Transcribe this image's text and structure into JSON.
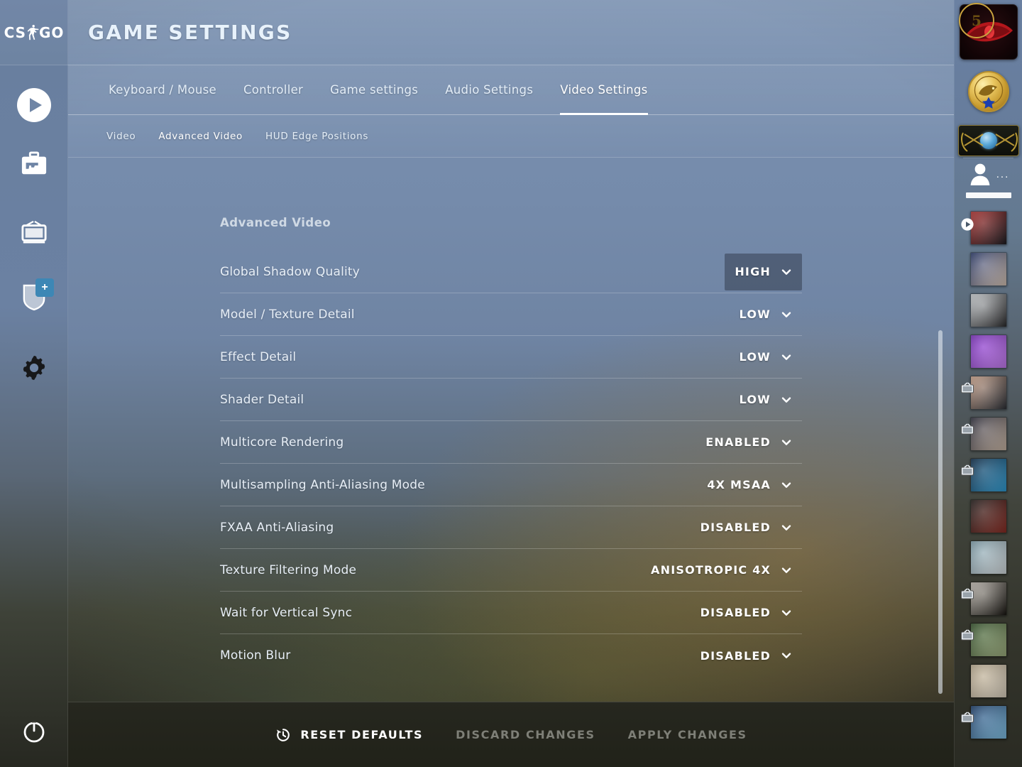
{
  "app": {
    "logo_left": "CS",
    "logo_right": "GO",
    "logo_icon": "csgo-soldier-icon"
  },
  "header": {
    "title": "GAME SETTINGS"
  },
  "sidebar": {
    "items": [
      {
        "id": "play",
        "icon": "play-icon",
        "label": "Play"
      },
      {
        "id": "inventory",
        "icon": "briefcase-gun-icon",
        "label": "Inventory"
      },
      {
        "id": "watch",
        "icon": "tv-icon",
        "label": "Watch"
      },
      {
        "id": "shield",
        "icon": "shield-icon",
        "label": "Profile",
        "badge": "+"
      },
      {
        "id": "settings",
        "icon": "gear-icon",
        "label": "Settings",
        "active": true
      },
      {
        "id": "power",
        "icon": "power-icon",
        "label": "Quit"
      }
    ]
  },
  "tabs": [
    {
      "label": "Keyboard / Mouse",
      "active": false
    },
    {
      "label": "Controller",
      "active": false
    },
    {
      "label": "Game settings",
      "active": false
    },
    {
      "label": "Audio Settings",
      "active": false
    },
    {
      "label": "Video Settings",
      "active": true
    }
  ],
  "subtabs": [
    {
      "label": "Video",
      "active": false
    },
    {
      "label": "Advanced Video",
      "active": true
    },
    {
      "label": "HUD Edge Positions",
      "active": false
    }
  ],
  "main": {
    "section_title": "Advanced Video",
    "settings": [
      {
        "label": "Global Shadow Quality",
        "value": "HIGH",
        "hovered": true
      },
      {
        "label": "Model / Texture Detail",
        "value": "LOW",
        "hovered": false
      },
      {
        "label": "Effect Detail",
        "value": "LOW",
        "hovered": false
      },
      {
        "label": "Shader Detail",
        "value": "LOW",
        "hovered": false
      },
      {
        "label": "Multicore Rendering",
        "value": "ENABLED",
        "hovered": false
      },
      {
        "label": "Multisampling Anti-Aliasing Mode",
        "value": "4X MSAA",
        "hovered": false
      },
      {
        "label": "FXAA Anti-Aliasing",
        "value": "DISABLED",
        "hovered": false
      },
      {
        "label": "Texture Filtering Mode",
        "value": "ANISOTROPIC 4X",
        "hovered": false
      },
      {
        "label": "Wait for Vertical Sync",
        "value": "DISABLED",
        "hovered": false
      },
      {
        "label": "Motion Blur",
        "value": "DISABLED",
        "hovered": false
      }
    ]
  },
  "footer": {
    "reset_label": "RESET DEFAULTS",
    "reset_icon": "history-clock-icon",
    "discard_label": "DISCARD CHANGES",
    "apply_label": "APPLY CHANGES"
  },
  "right_panel": {
    "badges": [
      {
        "id": "five-year-coin",
        "text": "5",
        "icon": "service-medal-coin-icon"
      },
      {
        "id": "operation-badge",
        "icon": "red-eye-operation-icon"
      },
      {
        "id": "eagle-medal",
        "icon": "gold-eagle-medal-icon"
      },
      {
        "id": "rank-badge",
        "icon": "global-elite-rank-icon"
      }
    ],
    "self": {
      "icon": "person-icon",
      "menu_icon": "ellipsis-icon",
      "menu_text": "..."
    },
    "friends": [
      {
        "id": "friend-1",
        "status_icon": "play-status-icon",
        "online": true,
        "c1": "#b0302e",
        "c2": "#1b1b20"
      },
      {
        "id": "friend-2",
        "status_icon": "",
        "online": true,
        "c1": "#2a3a6b",
        "c2": "#d9c6b7"
      },
      {
        "id": "friend-3",
        "status_icon": "",
        "online": true,
        "c1": "#c9cdd0",
        "c2": "#2a2a2c"
      },
      {
        "id": "friend-4",
        "status_icon": "",
        "online": true,
        "c1": "#7b2fbe",
        "c2": "#c77cf5"
      },
      {
        "id": "friend-5",
        "status_icon": "tv-status-icon",
        "online": true,
        "c1": "#caa28a",
        "c2": "#2c2f36"
      },
      {
        "id": "friend-6",
        "status_icon": "tv-status-icon",
        "online": true,
        "c1": "#2c2c3a",
        "c2": "#ccb8a6"
      },
      {
        "id": "friend-7",
        "status_icon": "tv-status-icon",
        "online": true,
        "c1": "#0d2a46",
        "c2": "#2f9fd8"
      },
      {
        "id": "friend-8",
        "status_icon": "",
        "online": true,
        "c1": "#201a18",
        "c2": "#8b2b22"
      },
      {
        "id": "friend-9",
        "status_icon": "",
        "online": true,
        "c1": "#7d9ca8",
        "c2": "#d6dde0"
      },
      {
        "id": "friend-10",
        "status_icon": "tv-status-icon",
        "online": true,
        "c1": "#bcb6ad",
        "c2": "#17140f"
      },
      {
        "id": "friend-11",
        "status_icon": "tv-status-icon",
        "online": true,
        "c1": "#33512a",
        "c2": "#9fb07e"
      },
      {
        "id": "friend-12",
        "status_icon": "",
        "online": true,
        "c1": "#b8a98e",
        "c2": "#dcd2c0"
      },
      {
        "id": "friend-13",
        "status_icon": "tv-status-icon",
        "online": true,
        "c1": "#1a3a66",
        "c2": "#7fc2e8"
      }
    ]
  },
  "colors": {
    "accent_blue": "#6f85a5",
    "badge_blue": "#3d87b5",
    "online_green": "#4c9e3a",
    "panel_dark": "#26271f",
    "text_primary": "#ffffff",
    "text_muted": "#7e7f77"
  }
}
